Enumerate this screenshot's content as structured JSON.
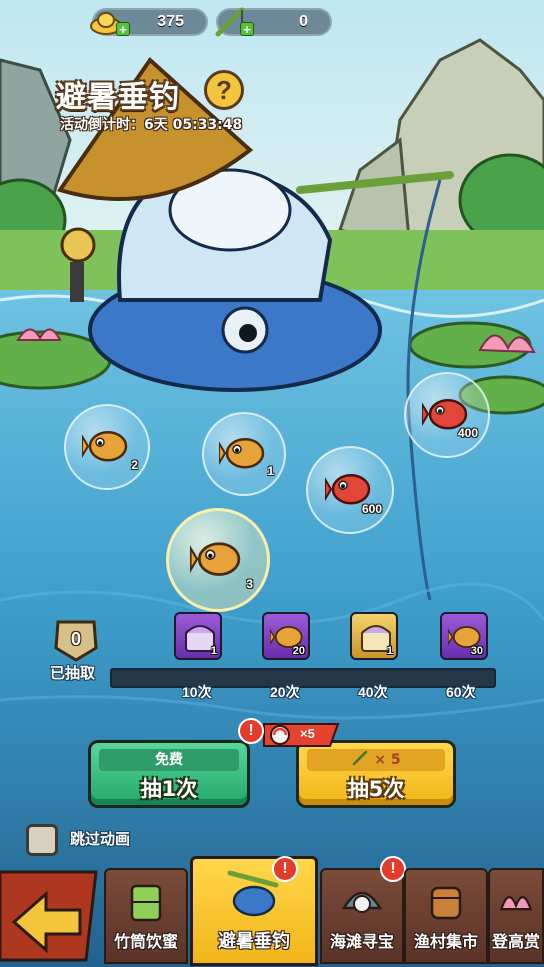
{
  "currency": {
    "gold_ingot": {
      "value": "375",
      "icon": "gold-ingot-icon"
    },
    "fishing_rod": {
      "value": "0",
      "icon": "fishing-rod-icon"
    }
  },
  "header": {
    "title": "避暑垂钓",
    "help_icon": "?",
    "countdown": "活动倒计时：6天 05:33:48"
  },
  "fish_bubbles": [
    {
      "fish": "golden-fish",
      "count": "2"
    },
    {
      "fish": "golden-fish",
      "count": "1"
    },
    {
      "fish": "red-fish",
      "count": "400"
    },
    {
      "fish": "red-fish",
      "count": "600"
    },
    {
      "fish": "golden-fish",
      "count": "3",
      "highlighted": true
    }
  ],
  "progress": {
    "drawn_count": "0",
    "drawn_label": "已抽取",
    "fill_fraction": 0,
    "milestones": [
      {
        "label": "10次",
        "reward": "purple-chest",
        "qty": "1",
        "frame": "purple"
      },
      {
        "label": "20次",
        "reward": "golden-fish",
        "qty": "20",
        "frame": "purple"
      },
      {
        "label": "40次",
        "reward": "gold-chest",
        "qty": "1",
        "frame": "gold"
      },
      {
        "label": "60次",
        "reward": "golden-fish",
        "qty": "30",
        "frame": "purple"
      }
    ]
  },
  "buttons": {
    "free": {
      "top": "免费",
      "main": "抽1次"
    },
    "five": {
      "top": "× 5",
      "main": "抽5次"
    },
    "bonus_tag": "×5",
    "alert": "!"
  },
  "skip": {
    "label": "跳过动画",
    "checked": false
  },
  "nav": {
    "tabs": [
      {
        "label": "竹筒饮蜜",
        "active": false,
        "alert": false
      },
      {
        "label": "避暑垂钓",
        "active": true,
        "alert": true
      },
      {
        "label": "海滩寻宝",
        "active": false,
        "alert": true
      },
      {
        "label": "渔村集市",
        "active": false,
        "alert": false
      },
      {
        "label": "登高赏",
        "active": false,
        "alert": false
      }
    ],
    "alert_mark": "!"
  },
  "colors": {
    "water": "#3d9bc9",
    "free_button": "#2dbb78",
    "five_button": "#f6c52a",
    "active_tab": "#f7c52a",
    "tab": "#6b4232"
  }
}
